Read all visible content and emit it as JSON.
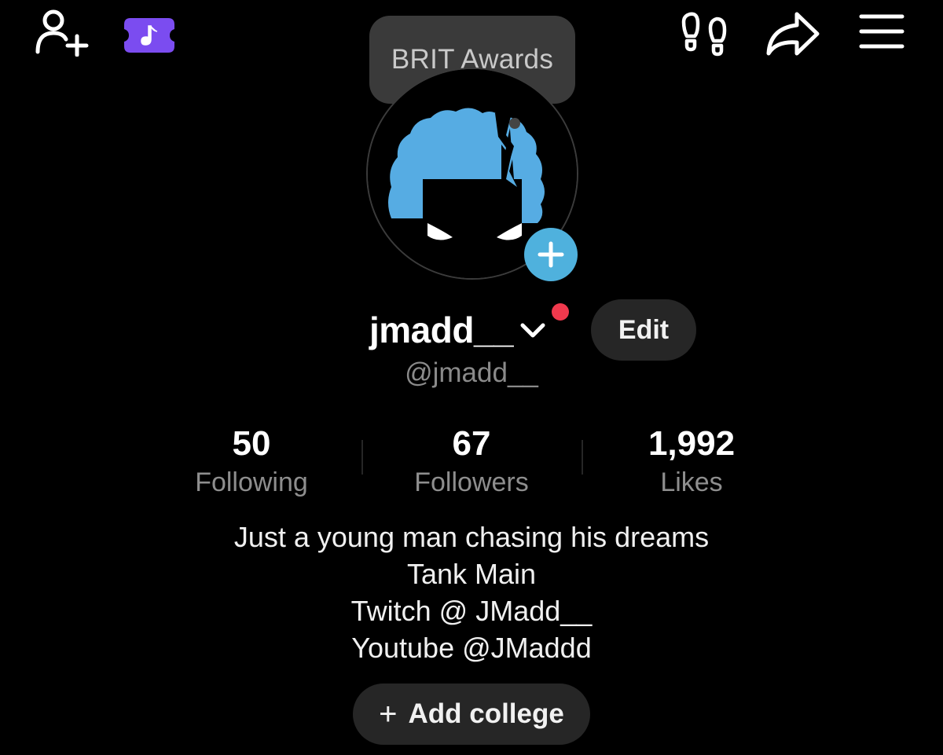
{
  "tooltip": {
    "text": "BRIT Awards"
  },
  "profile": {
    "username": "jmadd__",
    "handle": "@jmadd__",
    "edit_label": "Edit"
  },
  "stats": [
    {
      "value": "50",
      "label": "Following"
    },
    {
      "value": "67",
      "label": "Followers"
    },
    {
      "value": "1,992",
      "label": "Likes"
    }
  ],
  "bio": [
    "Just a young man chasing his dreams",
    "Tank Main",
    "Twitch @ JMadd__",
    "Youtube @JMaddd"
  ],
  "add_college": {
    "plus": "+",
    "label": "Add college"
  },
  "colors": {
    "background": "#000000",
    "accent_blue": "#4fb1dd",
    "avatar_hair": "#56ace3",
    "promo_purple": "#7b4cf0",
    "notification_red": "#f0394d",
    "button_bg": "#262626"
  },
  "icons": [
    "add-friend-icon",
    "tiktok-note-icon",
    "footprint-icon",
    "share-icon",
    "menu-icon",
    "chevron-down-icon",
    "plus-icon"
  ]
}
